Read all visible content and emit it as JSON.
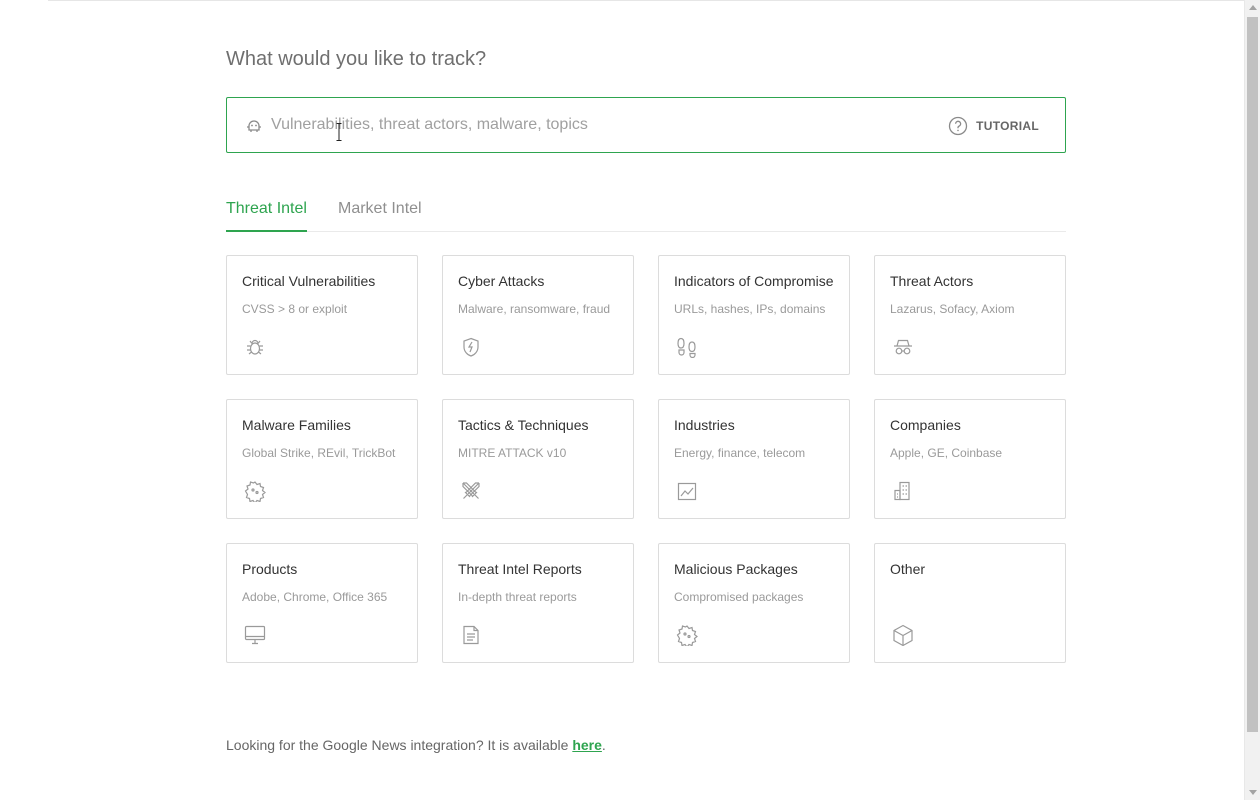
{
  "header": {
    "title": "What would you like to track?"
  },
  "search": {
    "placeholder": "Vulnerabilities, threat actors, malware, topics",
    "value": "",
    "icon": "bot-icon",
    "tutorial_label": "TUTORIAL",
    "tutorial_icon": "help-circle-icon"
  },
  "tabs": [
    {
      "label": "Threat Intel",
      "active": true
    },
    {
      "label": "Market Intel",
      "active": false
    }
  ],
  "cards": [
    {
      "title": "Critical Vulnerabilities",
      "subtitle": "CVSS > 8 or exploit",
      "icon": "bug-icon"
    },
    {
      "title": "Cyber Attacks",
      "subtitle": "Malware, ransomware, fraud",
      "icon": "shield-bolt-icon"
    },
    {
      "title": "Indicators of Compromise",
      "subtitle": "URLs, hashes, IPs, domains",
      "icon": "footprints-icon"
    },
    {
      "title": "Threat Actors",
      "subtitle": "Lazarus, Sofacy, Axiom",
      "icon": "spy-icon"
    },
    {
      "title": "Malware Families",
      "subtitle": "Global Strike, REvil, TrickBot",
      "icon": "virus-icon"
    },
    {
      "title": "Tactics & Techniques",
      "subtitle": "MITRE ATTACK v10",
      "icon": "crossed-swords-icon"
    },
    {
      "title": "Industries",
      "subtitle": "Energy, finance, telecom",
      "icon": "chart-icon"
    },
    {
      "title": "Companies",
      "subtitle": "Apple, GE, Coinbase",
      "icon": "building-icon"
    },
    {
      "title": "Products",
      "subtitle": "Adobe, Chrome, Office 365",
      "icon": "monitor-icon"
    },
    {
      "title": "Threat Intel Reports",
      "subtitle": "In-depth threat reports",
      "icon": "document-icon"
    },
    {
      "title": "Malicious Packages",
      "subtitle": "Compromised packages",
      "icon": "package-virus-icon"
    },
    {
      "title": "Other",
      "subtitle": "",
      "icon": "cube-icon"
    }
  ],
  "footer": {
    "text": "Looking for the Google News integration? It is available ",
    "link_label": "here",
    "suffix": "."
  },
  "colors": {
    "accent": "#2ea44f",
    "border": "#dcdcdc",
    "muted": "#9a9a9a"
  }
}
